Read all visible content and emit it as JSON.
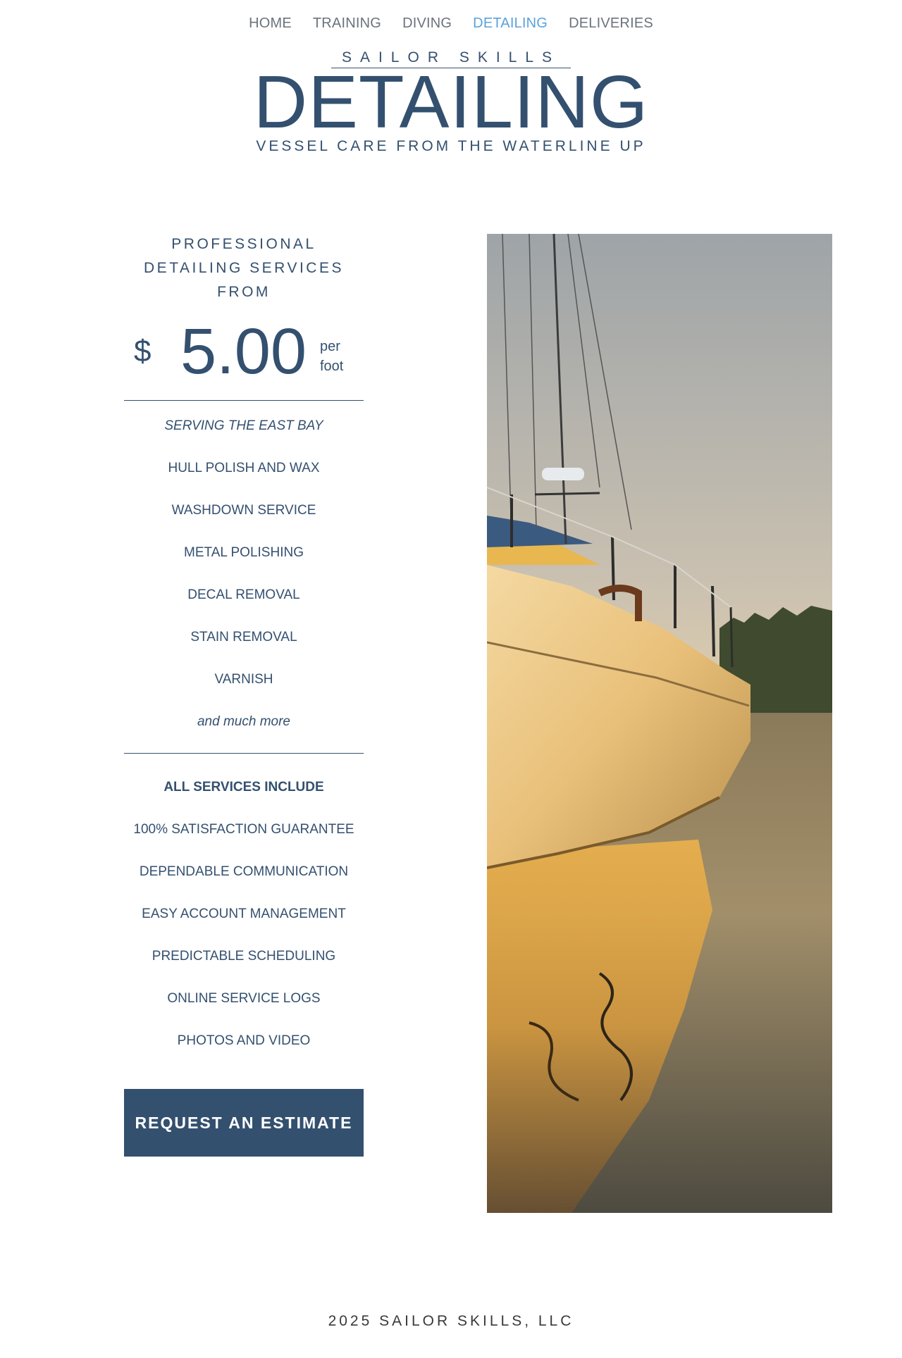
{
  "nav": {
    "items": [
      {
        "label": "HOME",
        "active": false
      },
      {
        "label": "TRAINING",
        "active": false
      },
      {
        "label": "DIVING",
        "active": false
      },
      {
        "label": "DETAILING",
        "active": true
      },
      {
        "label": "DELIVERIES",
        "active": false
      }
    ]
  },
  "header": {
    "brand": "SAILOR SKILLS",
    "title": "DETAILING",
    "tagline": "VESSEL CARE FROM THE WATERLINE UP"
  },
  "pricing": {
    "intro_line1": "PROFESSIONAL",
    "intro_line2": "DETAILING SERVICES",
    "intro_line3": "FROM",
    "currency": "$",
    "amount": "5.00",
    "unit_line1": "per",
    "unit_line2": "foot"
  },
  "services": {
    "area": "SERVING THE EAST BAY",
    "items": [
      "HULL POLISH AND WAX",
      "WASHDOWN SERVICE",
      "METAL POLISHING",
      "DECAL REMOVAL",
      "STAIN REMOVAL",
      "VARNISH"
    ],
    "more": "and much more"
  },
  "includes": {
    "heading": "ALL SERVICES INCLUDE",
    "items": [
      "100% SATISFACTION GUARANTEE",
      "DEPENDABLE COMMUNICATION",
      "EASY ACCOUNT MANAGEMENT",
      "PREDICTABLE SCHEDULING",
      "ONLINE SERVICE LOGS",
      "PHOTOS AND VIDEO"
    ]
  },
  "cta": {
    "label": "REQUEST AN ESTIMATE"
  },
  "footer": {
    "text": "2025 SAILOR SKILLS, LLC"
  },
  "colors": {
    "accent": "#34506f",
    "nav_active": "#5aa2db",
    "nav": "#6c737c"
  }
}
